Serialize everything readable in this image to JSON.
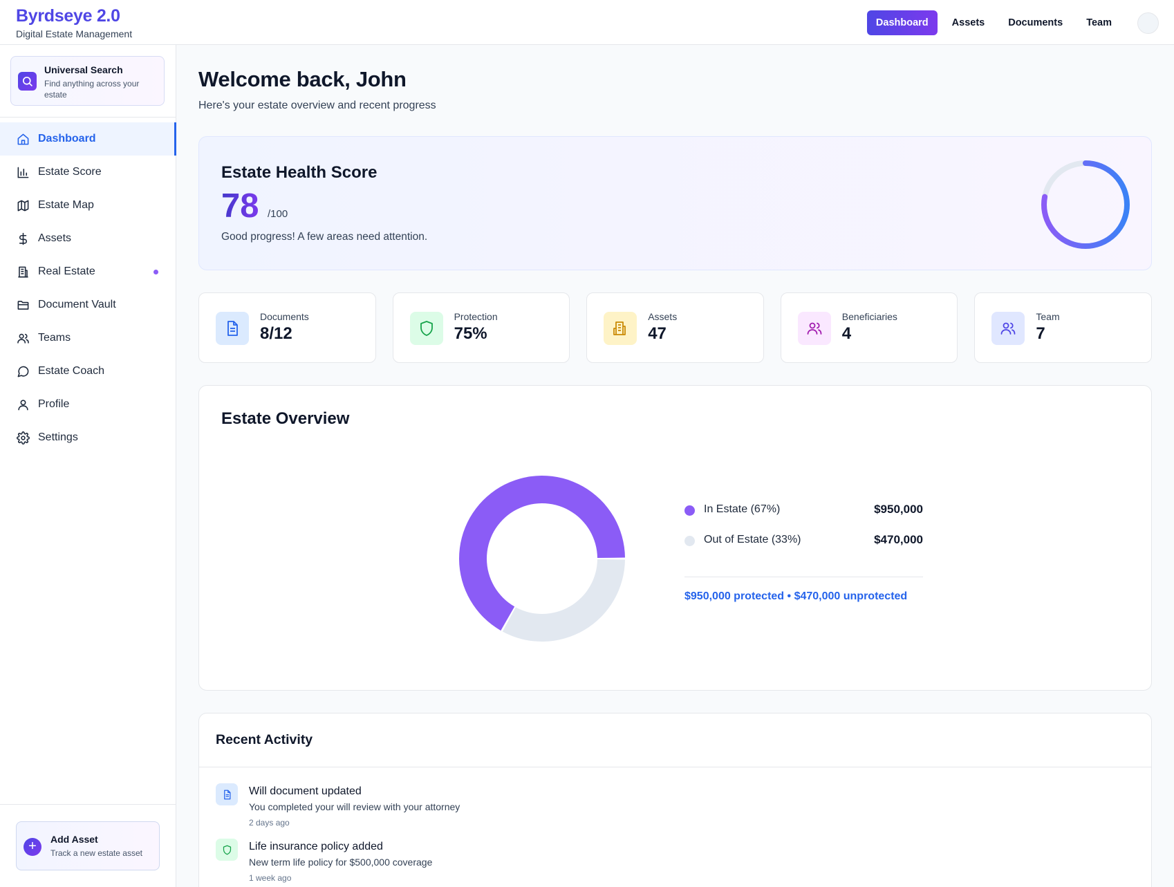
{
  "app": {
    "title": "Byrdseye 2.0",
    "subtitle": "Digital Estate Management"
  },
  "topnav": {
    "items": [
      "Dashboard",
      "Assets",
      "Documents",
      "Team"
    ],
    "active": "Dashboard"
  },
  "search": {
    "title": "Universal Search",
    "description": "Find anything across your estate"
  },
  "sidebar": {
    "items": [
      {
        "label": "Dashboard",
        "icon": "home-icon",
        "active": true
      },
      {
        "label": "Estate Score",
        "icon": "bar-chart-icon"
      },
      {
        "label": "Estate Map",
        "icon": "map-icon"
      },
      {
        "label": "Assets",
        "icon": "dollar-icon"
      },
      {
        "label": "Real Estate",
        "icon": "building-icon",
        "badge_dot": true
      },
      {
        "label": "Document Vault",
        "icon": "folder-icon"
      },
      {
        "label": "Teams",
        "icon": "users-icon"
      },
      {
        "label": "Estate Coach",
        "icon": "chat-icon"
      },
      {
        "label": "Profile",
        "icon": "user-icon"
      },
      {
        "label": "Settings",
        "icon": "gear-icon"
      }
    ],
    "add_asset": {
      "title": "Add Asset",
      "description": "Track a new estate asset"
    }
  },
  "welcome": {
    "heading": "Welcome back, John",
    "subheading": "Here's your estate overview and recent progress"
  },
  "health": {
    "title": "Estate Health Score",
    "score": "78",
    "max": "/100",
    "message": "Good progress! A few areas need attention.",
    "score_fraction": 0.78
  },
  "stats": [
    {
      "label": "Documents",
      "value": "8/12",
      "icon": "document-icon",
      "bg": "#dbeafe",
      "fg": "#2563eb"
    },
    {
      "label": "Protection",
      "value": "75%",
      "icon": "shield-icon",
      "bg": "#dcfce7",
      "fg": "#16a34a"
    },
    {
      "label": "Assets",
      "value": "47",
      "icon": "building-icon",
      "bg": "#fef3c7",
      "fg": "#ca8a04"
    },
    {
      "label": "Beneficiaries",
      "value": "4",
      "icon": "users-icon",
      "bg": "#fae8ff",
      "fg": "#a21caf"
    },
    {
      "label": "Team",
      "value": "7",
      "icon": "users-icon",
      "bg": "#e0e7ff",
      "fg": "#4f46e5"
    }
  ],
  "overview": {
    "title": "Estate Overview",
    "summary": "$950,000 protected • $470,000 unprotected"
  },
  "chart_data": {
    "type": "pie",
    "categories": [
      "In Estate (67%)",
      "Out of Estate (33%)"
    ],
    "values": [
      950000,
      470000
    ],
    "value_labels": [
      "$950,000",
      "$470,000"
    ],
    "colors": [
      "#8b5cf6",
      "#e2e8f0"
    ],
    "legend": "right"
  },
  "activity": {
    "title": "Recent Activity",
    "items": [
      {
        "title": "Will document updated",
        "description": "You completed your will review with your attorney",
        "time": "2 days ago",
        "icon": "document-icon"
      },
      {
        "title": "Life insurance policy added",
        "description": "New term life policy for $500,000 coverage",
        "time": "1 week ago",
        "icon": "shield-icon"
      }
    ]
  },
  "colors": {
    "accent": "#4f46e5",
    "accent_purple": "#7c3aed",
    "link_blue": "#2563eb"
  }
}
